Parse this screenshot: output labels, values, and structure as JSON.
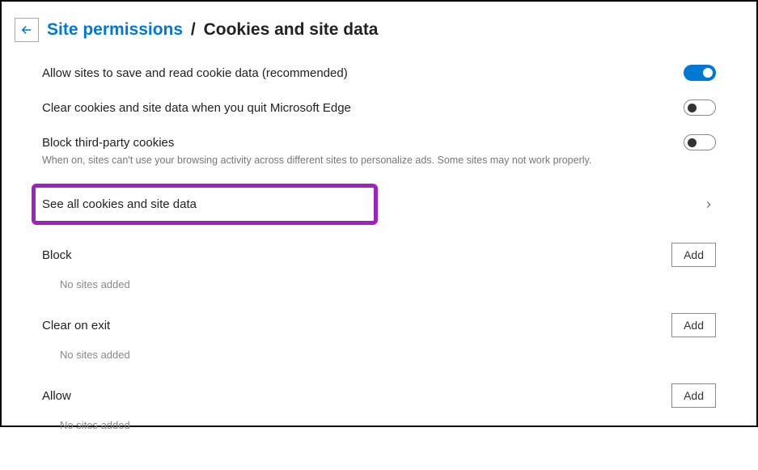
{
  "header": {
    "breadcrumb_link": "Site permissions",
    "breadcrumb_sep": "/",
    "breadcrumb_current": "Cookies and site data"
  },
  "settings": {
    "allow_cookies": {
      "label": "Allow sites to save and read cookie data (recommended)",
      "enabled": true
    },
    "clear_on_quit": {
      "label": "Clear cookies and site data when you quit Microsoft Edge",
      "enabled": false
    },
    "block_third_party": {
      "label": "Block third-party cookies",
      "description": "When on, sites can't use your browsing activity across different sites to personalize ads. Some sites may not work properly.",
      "enabled": false
    },
    "see_all": {
      "label": "See all cookies and site data"
    }
  },
  "sections": {
    "block": {
      "title": "Block",
      "add_label": "Add",
      "empty": "No sites added"
    },
    "clear_on_exit": {
      "title": "Clear on exit",
      "add_label": "Add",
      "empty": "No sites added"
    },
    "allow": {
      "title": "Allow",
      "add_label": "Add",
      "empty": "No sites added"
    }
  }
}
